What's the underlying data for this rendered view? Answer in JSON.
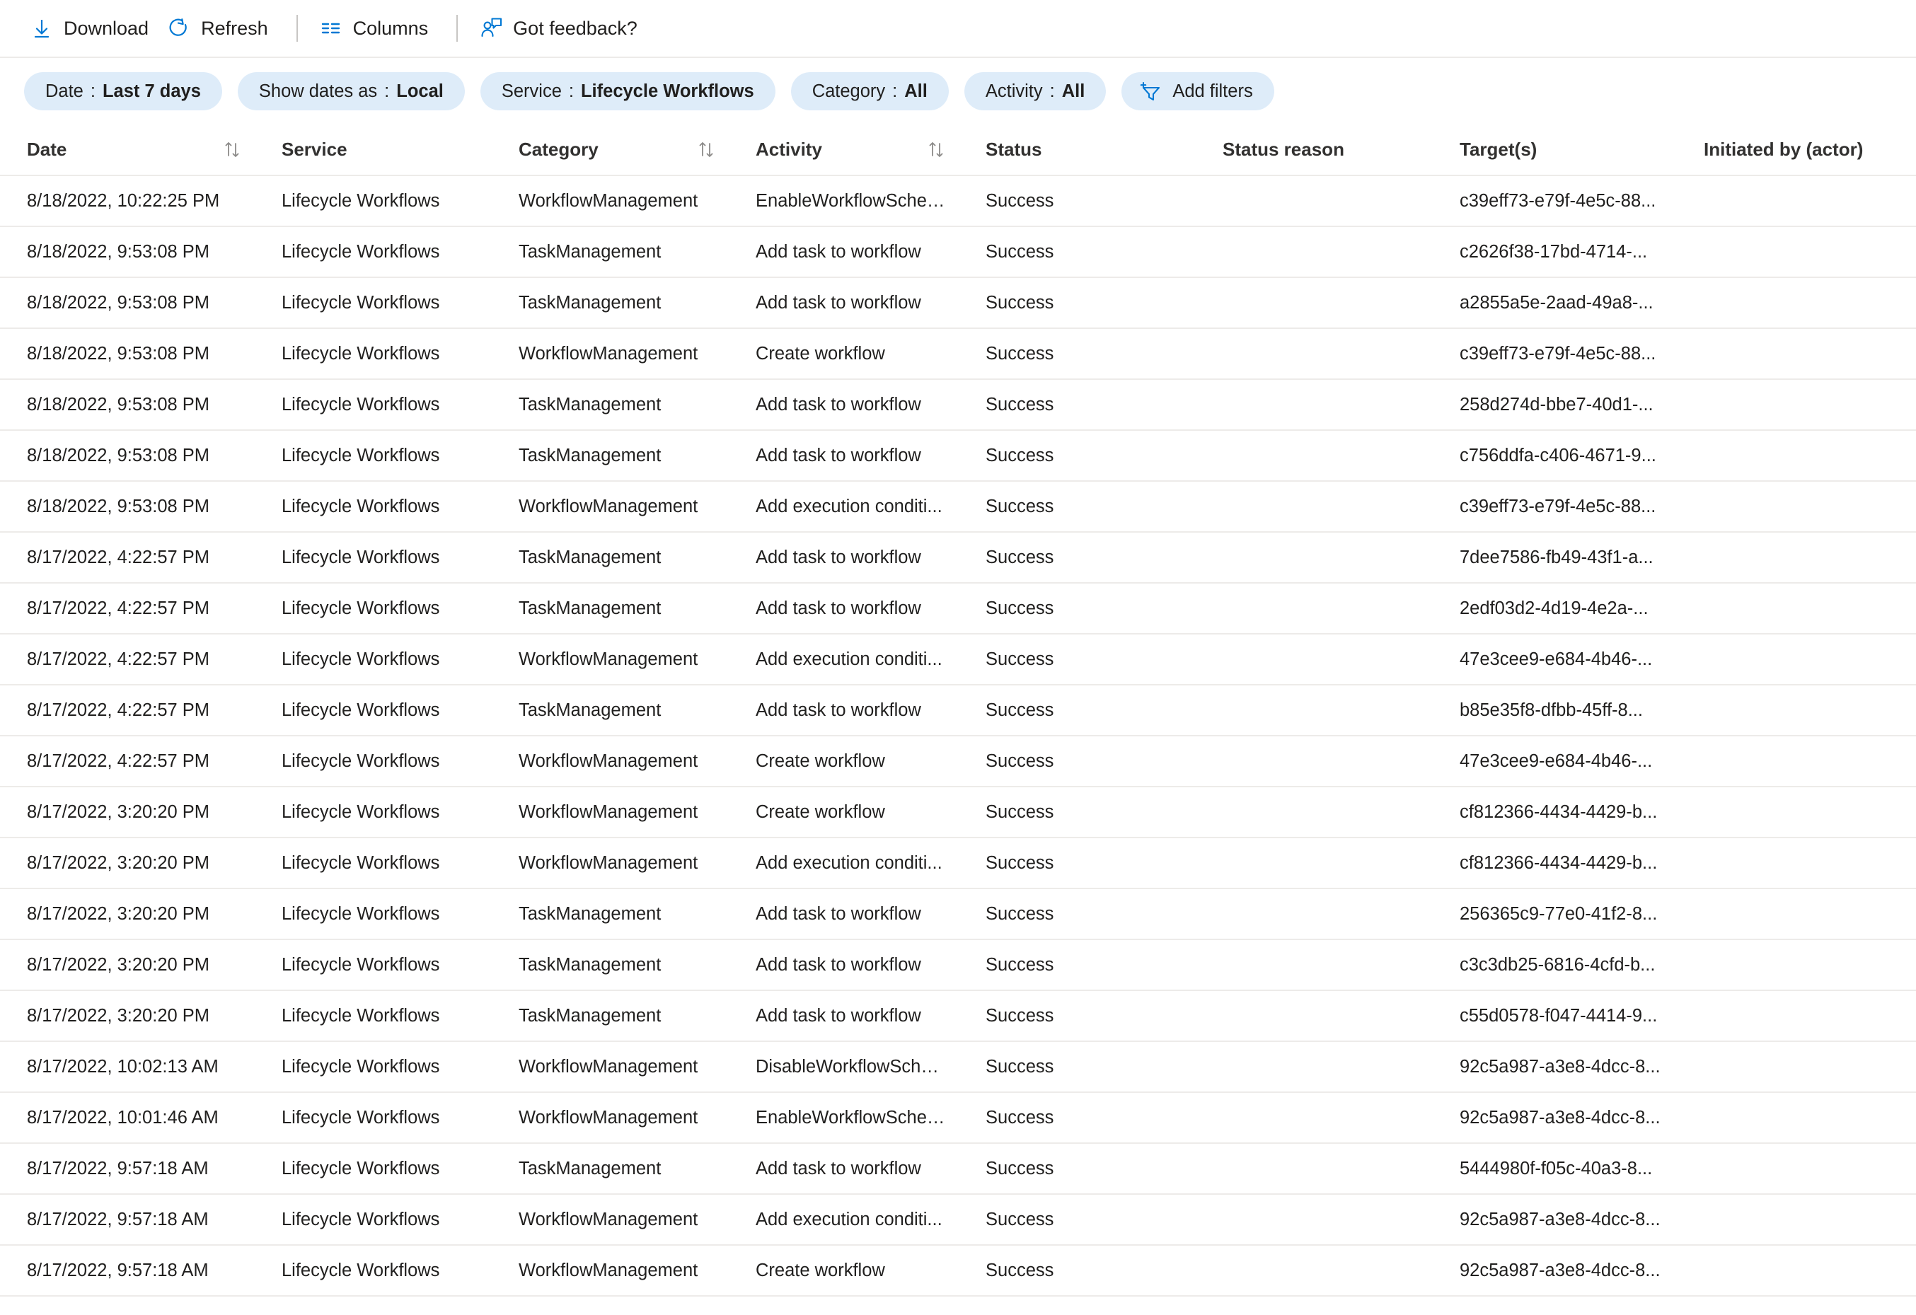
{
  "toolbar": {
    "buttons": [
      {
        "label": "Download",
        "icon": "download-icon"
      },
      {
        "label": "Refresh",
        "icon": "refresh-icon"
      },
      {
        "label": "Columns",
        "icon": "columns-icon"
      },
      {
        "label": "Got feedback?",
        "icon": "feedback-person-icon"
      }
    ],
    "separators_after": [
      1,
      2
    ]
  },
  "filters": [
    {
      "key": "Date",
      "value": "Last 7 days",
      "name": "filter-pill-date"
    },
    {
      "key": "Show dates as",
      "value": "Local",
      "name": "filter-pill-show-dates-as"
    },
    {
      "key": "Service",
      "value": "Lifecycle Workflows",
      "name": "filter-pill-service"
    },
    {
      "key": "Category",
      "value": "All",
      "name": "filter-pill-category"
    },
    {
      "key": "Activity",
      "value": "All",
      "name": "filter-pill-activity"
    }
  ],
  "add_filters": {
    "label": "Add filters",
    "icon": "add-filter-icon"
  },
  "table": {
    "columns": [
      {
        "label": "Date",
        "sortable": true,
        "key": "date"
      },
      {
        "label": "Service",
        "sortable": false,
        "key": "service"
      },
      {
        "label": "Category",
        "sortable": true,
        "key": "category"
      },
      {
        "label": "Activity",
        "sortable": true,
        "key": "activity"
      },
      {
        "label": "Status",
        "sortable": false,
        "key": "status"
      },
      {
        "label": "Status reason",
        "sortable": false,
        "key": "status_reason"
      },
      {
        "label": "Target(s)",
        "sortable": false,
        "key": "targets"
      },
      {
        "label": "Initiated by (actor)",
        "sortable": false,
        "key": "actor"
      }
    ],
    "rows": [
      {
        "date": "8/18/2022, 10:22:25 PM",
        "service": "Lifecycle Workflows",
        "category": "WorkflowManagement",
        "activity": "EnableWorkflowSched...",
        "status": "Success",
        "status_reason": "",
        "targets": "c39eff73-e79f-4e5c-88...",
        "actor": ""
      },
      {
        "date": "8/18/2022, 9:53:08 PM",
        "service": "Lifecycle Workflows",
        "category": "TaskManagement",
        "activity": "Add task to workflow",
        "status": "Success",
        "status_reason": "",
        "targets": "c2626f38-17bd-4714-...",
        "actor": ""
      },
      {
        "date": "8/18/2022, 9:53:08 PM",
        "service": "Lifecycle Workflows",
        "category": "TaskManagement",
        "activity": "Add task to workflow",
        "status": "Success",
        "status_reason": "",
        "targets": "a2855a5e-2aad-49a8-...",
        "actor": ""
      },
      {
        "date": "8/18/2022, 9:53:08 PM",
        "service": "Lifecycle Workflows",
        "category": "WorkflowManagement",
        "activity": "Create workflow",
        "status": "Success",
        "status_reason": "",
        "targets": "c39eff73-e79f-4e5c-88...",
        "actor": ""
      },
      {
        "date": "8/18/2022, 9:53:08 PM",
        "service": "Lifecycle Workflows",
        "category": "TaskManagement",
        "activity": "Add task to workflow",
        "status": "Success",
        "status_reason": "",
        "targets": "258d274d-bbe7-40d1-...",
        "actor": ""
      },
      {
        "date": "8/18/2022, 9:53:08 PM",
        "service": "Lifecycle Workflows",
        "category": "TaskManagement",
        "activity": "Add task to workflow",
        "status": "Success",
        "status_reason": "",
        "targets": "c756ddfa-c406-4671-9...",
        "actor": ""
      },
      {
        "date": "8/18/2022, 9:53:08 PM",
        "service": "Lifecycle Workflows",
        "category": "WorkflowManagement",
        "activity": "Add execution conditi...",
        "status": "Success",
        "status_reason": "",
        "targets": "c39eff73-e79f-4e5c-88...",
        "actor": ""
      },
      {
        "date": "8/17/2022, 4:22:57 PM",
        "service": "Lifecycle Workflows",
        "category": "TaskManagement",
        "activity": "Add task to workflow",
        "status": "Success",
        "status_reason": "",
        "targets": "7dee7586-fb49-43f1-a...",
        "actor": ""
      },
      {
        "date": "8/17/2022, 4:22:57 PM",
        "service": "Lifecycle Workflows",
        "category": "TaskManagement",
        "activity": "Add task to workflow",
        "status": "Success",
        "status_reason": "",
        "targets": "2edf03d2-4d19-4e2a-...",
        "actor": ""
      },
      {
        "date": "8/17/2022, 4:22:57 PM",
        "service": "Lifecycle Workflows",
        "category": "WorkflowManagement",
        "activity": "Add execution conditi...",
        "status": "Success",
        "status_reason": "",
        "targets": "47e3cee9-e684-4b46-...",
        "actor": ""
      },
      {
        "date": "8/17/2022, 4:22:57 PM",
        "service": "Lifecycle Workflows",
        "category": "TaskManagement",
        "activity": "Add task to workflow",
        "status": "Success",
        "status_reason": "",
        "targets": "b85e35f8-dfbb-45ff-8...",
        "actor": ""
      },
      {
        "date": "8/17/2022, 4:22:57 PM",
        "service": "Lifecycle Workflows",
        "category": "WorkflowManagement",
        "activity": "Create workflow",
        "status": "Success",
        "status_reason": "",
        "targets": "47e3cee9-e684-4b46-...",
        "actor": ""
      },
      {
        "date": "8/17/2022, 3:20:20 PM",
        "service": "Lifecycle Workflows",
        "category": "WorkflowManagement",
        "activity": "Create workflow",
        "status": "Success",
        "status_reason": "",
        "targets": "cf812366-4434-4429-b...",
        "actor": ""
      },
      {
        "date": "8/17/2022, 3:20:20 PM",
        "service": "Lifecycle Workflows",
        "category": "WorkflowManagement",
        "activity": "Add execution conditi...",
        "status": "Success",
        "status_reason": "",
        "targets": "cf812366-4434-4429-b...",
        "actor": ""
      },
      {
        "date": "8/17/2022, 3:20:20 PM",
        "service": "Lifecycle Workflows",
        "category": "TaskManagement",
        "activity": "Add task to workflow",
        "status": "Success",
        "status_reason": "",
        "targets": "256365c9-77e0-41f2-8...",
        "actor": ""
      },
      {
        "date": "8/17/2022, 3:20:20 PM",
        "service": "Lifecycle Workflows",
        "category": "TaskManagement",
        "activity": "Add task to workflow",
        "status": "Success",
        "status_reason": "",
        "targets": "c3c3db25-6816-4cfd-b...",
        "actor": ""
      },
      {
        "date": "8/17/2022, 3:20:20 PM",
        "service": "Lifecycle Workflows",
        "category": "TaskManagement",
        "activity": "Add task to workflow",
        "status": "Success",
        "status_reason": "",
        "targets": "c55d0578-f047-4414-9...",
        "actor": ""
      },
      {
        "date": "8/17/2022, 10:02:13 AM",
        "service": "Lifecycle Workflows",
        "category": "WorkflowManagement",
        "activity": "DisableWorkflowSched...",
        "status": "Success",
        "status_reason": "",
        "targets": "92c5a987-a3e8-4dcc-8...",
        "actor": ""
      },
      {
        "date": "8/17/2022, 10:01:46 AM",
        "service": "Lifecycle Workflows",
        "category": "WorkflowManagement",
        "activity": "EnableWorkflowSched...",
        "status": "Success",
        "status_reason": "",
        "targets": "92c5a987-a3e8-4dcc-8...",
        "actor": ""
      },
      {
        "date": "8/17/2022, 9:57:18 AM",
        "service": "Lifecycle Workflows",
        "category": "TaskManagement",
        "activity": "Add task to workflow",
        "status": "Success",
        "status_reason": "",
        "targets": "5444980f-f05c-40a3-8...",
        "actor": ""
      },
      {
        "date": "8/17/2022, 9:57:18 AM",
        "service": "Lifecycle Workflows",
        "category": "WorkflowManagement",
        "activity": "Add execution conditi...",
        "status": "Success",
        "status_reason": "",
        "targets": "92c5a987-a3e8-4dcc-8...",
        "actor": ""
      },
      {
        "date": "8/17/2022, 9:57:18 AM",
        "service": "Lifecycle Workflows",
        "category": "WorkflowManagement",
        "activity": "Create workflow",
        "status": "Success",
        "status_reason": "",
        "targets": "92c5a987-a3e8-4dcc-8...",
        "actor": ""
      }
    ]
  },
  "colors": {
    "accent": "#0078d4",
    "pill_bg": "#deecf9",
    "row_border": "#edebe9",
    "text": "#201f1e"
  }
}
